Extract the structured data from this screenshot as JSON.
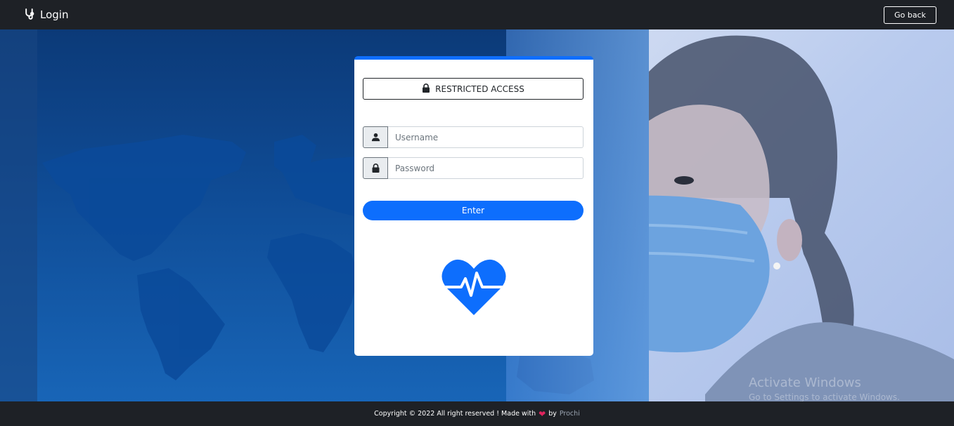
{
  "navbar": {
    "brand_label": "Login",
    "brand_icon": "stethoscope-icon",
    "go_back_label": "Go back"
  },
  "card": {
    "restricted_label": "RESTRICTED ACCESS",
    "restricted_icon": "lock-icon",
    "username_placeholder": "Username",
    "username_value": "",
    "password_placeholder": "Password",
    "password_value": "",
    "enter_label": "Enter",
    "logo_icon": "heartbeat-icon"
  },
  "footer": {
    "text": "Copyright © 2022 All right reserved ! Made with",
    "heart": "❤",
    "by": "by",
    "author": "Prochi"
  },
  "watermark": {
    "line1": "Activate Windows",
    "line2": "Go to Settings to activate Windows."
  },
  "colors": {
    "accent": "#0d6efd",
    "navbar": "#1e2126",
    "background": "#0f4c96"
  }
}
